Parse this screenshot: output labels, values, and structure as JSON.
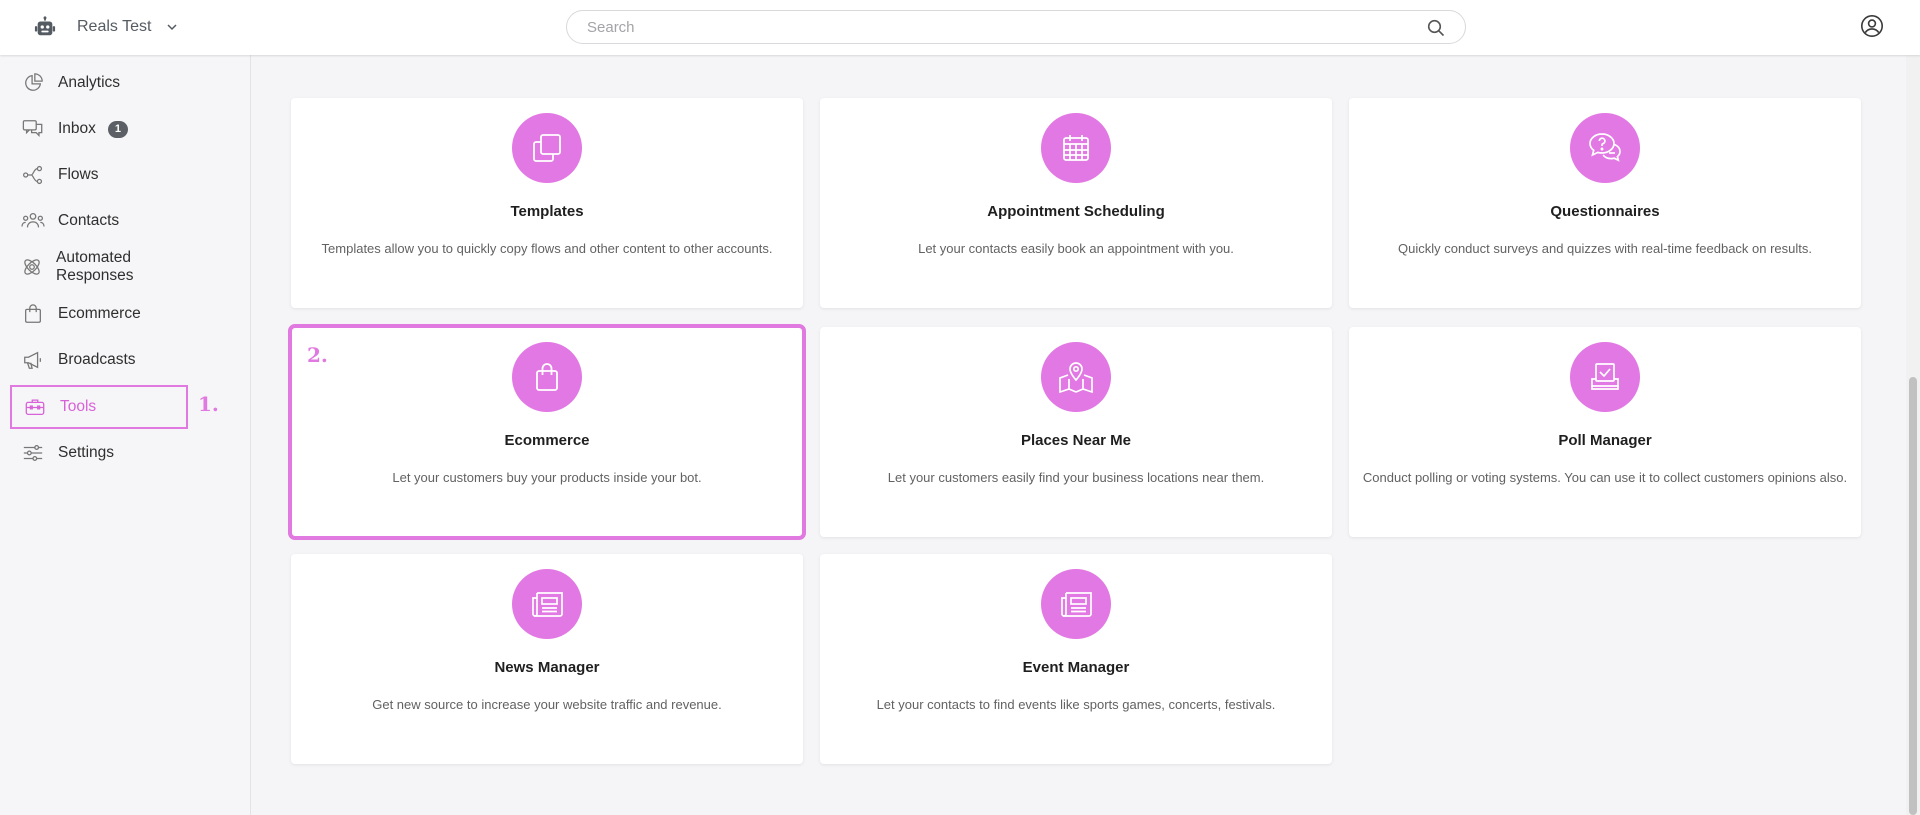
{
  "header": {
    "app_name": "Reals Test",
    "search_placeholder": "Search"
  },
  "sidebar": {
    "items": [
      {
        "label": "Analytics",
        "icon": "pie-chart-icon"
      },
      {
        "label": "Inbox",
        "icon": "chat-bubbles-icon",
        "badge": "1"
      },
      {
        "label": "Flows",
        "icon": "flow-icon"
      },
      {
        "label": "Contacts",
        "icon": "contacts-icon"
      },
      {
        "label": "Automated Responses",
        "icon": "automation-icon"
      },
      {
        "label": "Ecommerce",
        "icon": "shopping-bag-icon"
      },
      {
        "label": "Broadcasts",
        "icon": "megaphone-icon"
      },
      {
        "label": "Tools",
        "icon": "toolbox-icon",
        "active": true
      },
      {
        "label": "Settings",
        "icon": "sliders-icon"
      }
    ],
    "annotation": "1."
  },
  "cards": [
    {
      "title": "Templates",
      "description": "Templates allow you to quickly copy flows and other content to other accounts.",
      "icon": "copy-icon"
    },
    {
      "title": "Appointment Scheduling",
      "description": "Let your contacts easily book an appointment with you.",
      "icon": "calendar-icon"
    },
    {
      "title": "Questionnaires",
      "description": "Quickly conduct surveys and quizzes with real-time feedback on results.",
      "icon": "question-bubbles-icon"
    },
    {
      "title": "Ecommerce",
      "description": "Let your customers buy your products inside your bot.",
      "icon": "shopping-bag-icon",
      "annotation": "2."
    },
    {
      "title": "Places Near Me",
      "description": "Let your customers easily find your business locations near them.",
      "icon": "map-pin-icon"
    },
    {
      "title": "Poll Manager",
      "description": "Conduct polling or voting systems. You can use it to collect customers opinions also.",
      "icon": "ballot-box-icon"
    },
    {
      "title": "News Manager",
      "description": "Get new source to increase your website traffic and revenue.",
      "icon": "newspaper-icon"
    },
    {
      "title": "Event Manager",
      "description": "Let your contacts to find events like sports games, concerts, festivals.",
      "icon": "newspaper-icon"
    }
  ],
  "colors": {
    "accent": "#e278e3",
    "highlight": "#e07ae0",
    "badge": "#5c6066"
  }
}
